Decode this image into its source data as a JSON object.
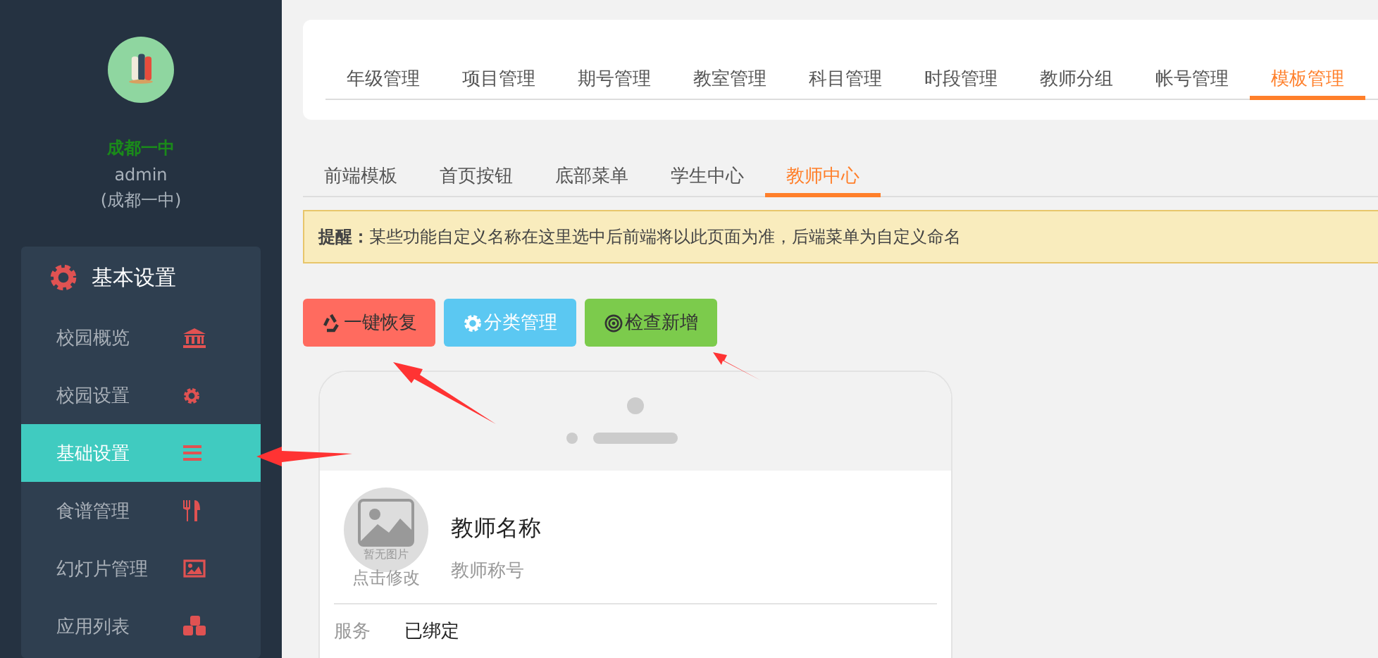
{
  "sidebar": {
    "school": "成都一中",
    "user": "admin",
    "user_school": "(成都一中)",
    "menu": {
      "title": "基本设置",
      "items": [
        {
          "label": "校园概览",
          "kind": "bank",
          "selected": false
        },
        {
          "label": "校园设置",
          "kind": "gear",
          "selected": false
        },
        {
          "label": "基础设置",
          "kind": "bars",
          "selected": true
        },
        {
          "label": "食谱管理",
          "kind": "cutlery",
          "selected": false
        },
        {
          "label": "幻灯片管理",
          "kind": "image",
          "selected": false
        },
        {
          "label": "应用列表",
          "kind": "cubes",
          "selected": false
        }
      ]
    }
  },
  "tabs": [
    {
      "label": "年级管理",
      "selected": false
    },
    {
      "label": "项目管理",
      "selected": false
    },
    {
      "label": "期号管理",
      "selected": false
    },
    {
      "label": "教室管理",
      "selected": false
    },
    {
      "label": "科目管理",
      "selected": false
    },
    {
      "label": "时段管理",
      "selected": false
    },
    {
      "label": "教师分组",
      "selected": false
    },
    {
      "label": "帐号管理",
      "selected": false
    },
    {
      "label": "模板管理",
      "selected": true
    }
  ],
  "subtabs": [
    {
      "label": "前端模板",
      "selected": false
    },
    {
      "label": "首页按钮",
      "selected": false
    },
    {
      "label": "底部菜单",
      "selected": false
    },
    {
      "label": "学生中心",
      "selected": false
    },
    {
      "label": "教师中心",
      "selected": true
    }
  ],
  "notice": "**提醒：**某些功能自定义名称在这里选中后前端将以此页面为准，后端菜单为自定义命名",
  "buttons": [
    {
      "label": "一键恢复",
      "kind": "restore"
    },
    {
      "label": "分类管理",
      "kind": "category"
    },
    {
      "label": "检查新增",
      "kind": "check"
    }
  ],
  "preview": {
    "avatar_placeholder": "暂无图片",
    "avatar_hint": "点击修改",
    "name": "教师名称",
    "title": "教师称号",
    "rows": [
      {
        "label": "服务",
        "value": "已绑定"
      }
    ]
  }
}
